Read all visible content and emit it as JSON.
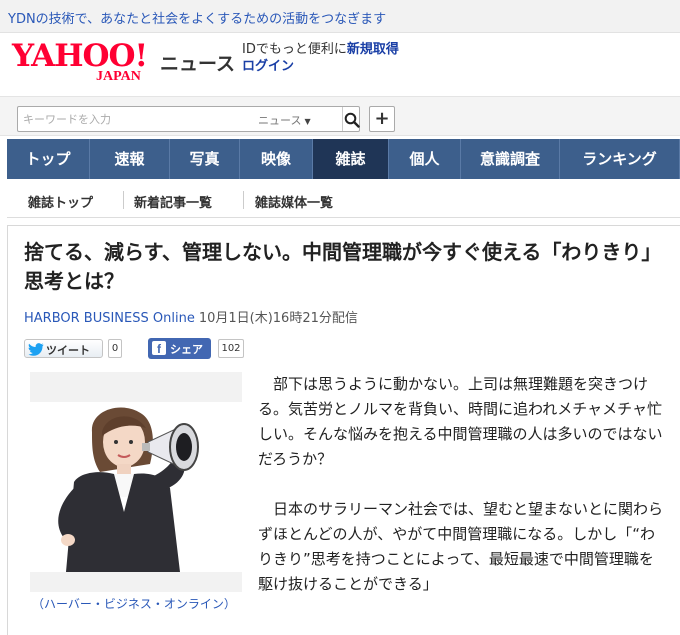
{
  "topbar": {
    "link": "YDNの技術で、あなたと社会をよくするための活動をつなぎます"
  },
  "header": {
    "logo_word": "YAHOO!",
    "logo_sub": "JAPAN",
    "brand": "ニュース",
    "id_lead": "IDでもっと便利に",
    "signup": "新規取得",
    "login": "ログイン"
  },
  "search": {
    "placeholder": "キーワードを入力",
    "scope": "ニュース",
    "plus": "+"
  },
  "nav": {
    "items": [
      "トップ",
      "速報",
      "写真",
      "映像",
      "雑誌",
      "個人",
      "意識調査",
      "ランキング"
    ],
    "active": "雑誌"
  },
  "subnav": [
    "雑誌トップ",
    "新着記事一覧",
    "雑誌媒体一覧"
  ],
  "article": {
    "title": "捨てる、減らす、管理しない。中間管理職が今すぐ使える「わりきり」思考とは？",
    "source": "HARBOR BUSINESS Online",
    "date": "10月1日(木)16時21分配信",
    "tweet_label": "ツイート",
    "tweet_count": "0",
    "share_label": "シェア",
    "share_count": "102",
    "caption": "（ハーバー・ビジネス・オンライン）",
    "paragraphs": [
      "部下は思うように動かない。上司は無理難題を突きつける。気苦労とノルマを背負い、時間に追われメチャメチャ忙しい。そんな悩みを抱える中間管理職の人は多いのではないだろうか？",
      "日本のサラリーマン社会では、望むと望まないとに関わらずほとんどの人が、やがて中間管理職になる。しかし「“わりきり”思考を持つことによって、最短最速で中間管理職を駆け抜けることができる」"
    ]
  },
  "colors": {
    "nav_bg": "#3d5f8c",
    "nav_active": "#1f3556",
    "logo_red": "#ff0033",
    "link_blue": "#2a58b8",
    "facebook": "#4267b2"
  }
}
